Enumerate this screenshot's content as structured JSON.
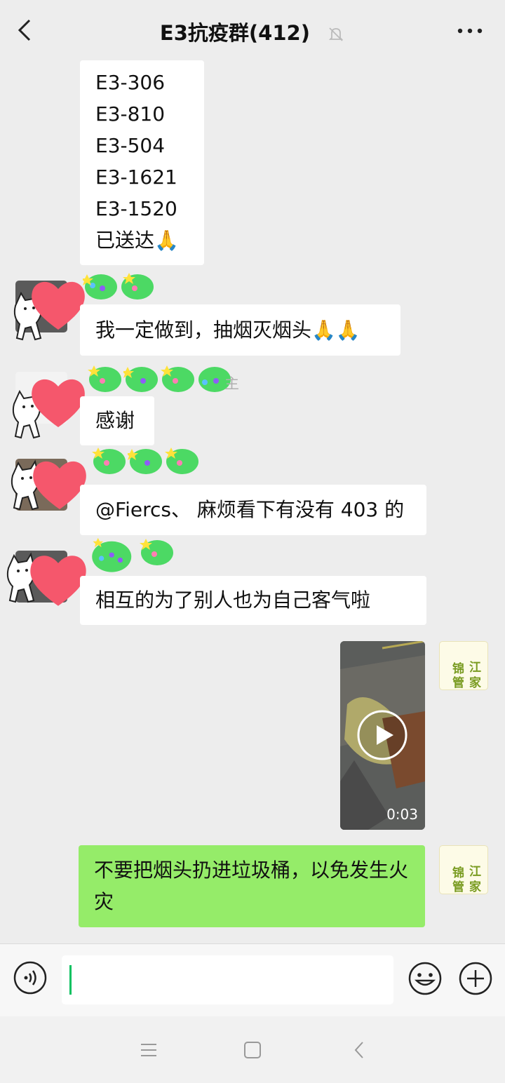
{
  "header": {
    "back_icon": "back-chevron-icon",
    "title": "E3抗疫群(412)",
    "mute_icon": "bell-muted-icon",
    "more_icon": "more-dots-icon"
  },
  "messages": [
    {
      "id": "m1",
      "lines": [
        "E3-306",
        "E3-810",
        "E3-504",
        "E3-1621",
        "E3-1520",
        "已送达🙏"
      ]
    },
    {
      "id": "m2",
      "text": "我一定做到，抽烟灭烟头🙏🙏"
    },
    {
      "id": "m3",
      "sender_partial": "主",
      "text": "感谢"
    },
    {
      "id": "m4",
      "text": "@Fiercs、 麻烦看下有没有 403 的"
    },
    {
      "id": "m5",
      "text": "相互的为了别人也为自己客气啦"
    },
    {
      "id": "m6",
      "type": "video",
      "duration": "0:03"
    },
    {
      "id": "m7",
      "text": "不要把烟头扔进垃圾桶，以免发生火灾"
    }
  ],
  "self_avatar": {
    "chars": [
      "锦",
      "江",
      "管",
      "家"
    ]
  },
  "input": {
    "voice_icon": "voice-icon",
    "emoji_icon": "emoji-icon",
    "plus_icon": "plus-icon"
  },
  "navbar": {
    "menu_icon": "menu-icon",
    "home_icon": "home-square-icon",
    "back_icon": "nav-back-icon"
  },
  "colors": {
    "bg": "#ededed",
    "bubble_self": "#95ec69",
    "bubble_other": "#ffffff",
    "heart": "#f5576c",
    "caret": "#07c160"
  }
}
